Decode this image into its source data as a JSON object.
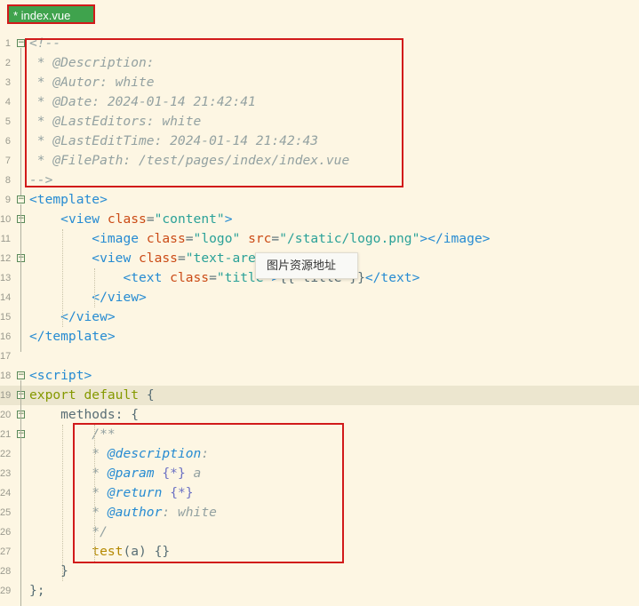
{
  "tab": {
    "label": "* index.vue"
  },
  "tooltip": {
    "text": "图片资源地址"
  },
  "lines": [
    {
      "n": "1",
      "fold": "minus",
      "segs": [
        [
          "c-cm",
          "<!--"
        ]
      ]
    },
    {
      "n": "2",
      "segs": [
        [
          "c-cm",
          " * @Description: "
        ]
      ]
    },
    {
      "n": "3",
      "segs": [
        [
          "c-cm",
          " * @Autor: white"
        ]
      ]
    },
    {
      "n": "4",
      "segs": [
        [
          "c-cm",
          " * @Date: 2024-01-14 21:42:41"
        ]
      ]
    },
    {
      "n": "5",
      "segs": [
        [
          "c-cm",
          " * @LastEditors: white"
        ]
      ]
    },
    {
      "n": "6",
      "segs": [
        [
          "c-cm",
          " * @LastEditTime: 2024-01-14 21:42:43"
        ]
      ]
    },
    {
      "n": "7",
      "segs": [
        [
          "c-cm",
          " * @FilePath: /test/pages/index/index.vue"
        ]
      ]
    },
    {
      "n": "8",
      "segs": [
        [
          "c-cm",
          "-->"
        ]
      ]
    },
    {
      "n": "9",
      "fold": "minus",
      "segs": [
        [
          "c-tag",
          "<template>"
        ]
      ]
    },
    {
      "n": "10",
      "fold": "minus",
      "segs": [
        [
          "c-txt",
          "    "
        ],
        [
          "c-tag",
          "<view "
        ],
        [
          "c-attr",
          "class"
        ],
        [
          "c-txt",
          "="
        ],
        [
          "c-str",
          "\"content\""
        ],
        [
          "c-tag",
          ">"
        ]
      ]
    },
    {
      "n": "11",
      "segs": [
        [
          "c-txt",
          "        "
        ],
        [
          "c-tag",
          "<image "
        ],
        [
          "c-attr",
          "class"
        ],
        [
          "c-txt",
          "="
        ],
        [
          "c-str",
          "\"logo\""
        ],
        [
          "c-txt",
          " "
        ],
        [
          "c-attr",
          "src"
        ],
        [
          "c-txt",
          "="
        ],
        [
          "c-str",
          "\"/static/logo.png\""
        ],
        [
          "c-tag",
          "></image>"
        ]
      ]
    },
    {
      "n": "12",
      "fold": "minus",
      "segs": [
        [
          "c-txt",
          "        "
        ],
        [
          "c-tag",
          "<view "
        ],
        [
          "c-attr",
          "class"
        ],
        [
          "c-txt",
          "="
        ],
        [
          "c-str",
          "\"text-are"
        ]
      ]
    },
    {
      "n": "13",
      "segs": [
        [
          "c-txt",
          "            "
        ],
        [
          "c-tag",
          "<text "
        ],
        [
          "c-attr",
          "class"
        ],
        [
          "c-txt",
          "="
        ],
        [
          "c-str",
          "\"title\""
        ],
        [
          "c-tag",
          ">"
        ],
        [
          "c-txt",
          "{{ title }}"
        ],
        [
          "c-tag",
          "</text>"
        ]
      ]
    },
    {
      "n": "14",
      "segs": [
        [
          "c-txt",
          "        "
        ],
        [
          "c-tag",
          "</view>"
        ]
      ]
    },
    {
      "n": "15",
      "segs": [
        [
          "c-txt",
          "    "
        ],
        [
          "c-tag",
          "</view>"
        ]
      ]
    },
    {
      "n": "16",
      "segs": [
        [
          "c-tag",
          "</template>"
        ]
      ]
    },
    {
      "n": "17",
      "segs": []
    },
    {
      "n": "18",
      "fold": "minus",
      "segs": [
        [
          "c-tag",
          "<script>"
        ]
      ]
    },
    {
      "n": "19",
      "fold": "minus",
      "hl": true,
      "segs": [
        [
          "c-kw",
          "export"
        ],
        [
          "c-txt",
          " "
        ],
        [
          "c-kw",
          "default"
        ],
        [
          "c-txt",
          " {"
        ]
      ]
    },
    {
      "n": "20",
      "fold": "minus",
      "segs": [
        [
          "c-txt",
          "    methods: {"
        ]
      ]
    },
    {
      "n": "21",
      "fold": "minus",
      "segs": [
        [
          "c-txt",
          "        "
        ],
        [
          "c-cm",
          "/**"
        ]
      ]
    },
    {
      "n": "22",
      "segs": [
        [
          "c-txt",
          "        "
        ],
        [
          "c-cm",
          "* "
        ],
        [
          "c-doctag",
          "@description"
        ],
        [
          "c-cm",
          ":"
        ]
      ]
    },
    {
      "n": "23",
      "segs": [
        [
          "c-txt",
          "        "
        ],
        [
          "c-cm",
          "* "
        ],
        [
          "c-doctag",
          "@param"
        ],
        [
          "c-cm",
          " "
        ],
        [
          "c-doc",
          "{*}"
        ],
        [
          "c-cm",
          " a"
        ]
      ]
    },
    {
      "n": "24",
      "segs": [
        [
          "c-txt",
          "        "
        ],
        [
          "c-cm",
          "* "
        ],
        [
          "c-doctag",
          "@return"
        ],
        [
          "c-cm",
          " "
        ],
        [
          "c-doc",
          "{*}"
        ]
      ]
    },
    {
      "n": "25",
      "segs": [
        [
          "c-txt",
          "        "
        ],
        [
          "c-cm",
          "* "
        ],
        [
          "c-doctag",
          "@author"
        ],
        [
          "c-cm",
          ": white"
        ]
      ]
    },
    {
      "n": "26",
      "segs": [
        [
          "c-txt",
          "        "
        ],
        [
          "c-cm",
          "*/"
        ]
      ]
    },
    {
      "n": "27",
      "segs": [
        [
          "c-txt",
          "        "
        ],
        [
          "c-fn",
          "test"
        ],
        [
          "c-txt",
          "(a) {}"
        ]
      ]
    },
    {
      "n": "28",
      "segs": [
        [
          "c-txt",
          "    }"
        ]
      ]
    },
    {
      "n": "29",
      "segs": [
        [
          "c-txt",
          "};"
        ]
      ]
    }
  ]
}
